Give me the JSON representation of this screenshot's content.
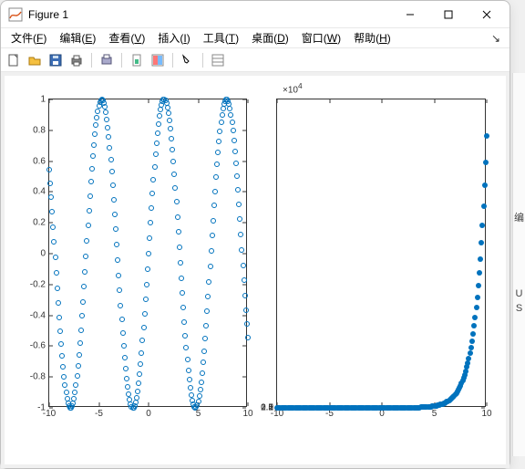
{
  "window": {
    "title": "Figure 1"
  },
  "menu": {
    "file": "文件(F)",
    "edit": "编辑(E)",
    "view": "查看(V)",
    "insert": "插入(I)",
    "tools": "工具(T)",
    "desktop": "桌面(D)",
    "window": "窗口(W)",
    "help": "帮助(H)"
  },
  "chart_data": [
    {
      "type": "scatter",
      "marker": "open-circle",
      "color": "#0072bd",
      "x_expr": "linspace(-10, 10, 201)",
      "y_expr": "sin(x)",
      "xlim": [
        -10,
        10
      ],
      "ylim": [
        -1,
        1
      ],
      "xticks": [
        -10,
        -5,
        0,
        5,
        10
      ],
      "yticks": [
        -1,
        -0.8,
        -0.6,
        -0.4,
        -0.2,
        0,
        0.2,
        0.4,
        0.6,
        0.8,
        1
      ]
    },
    {
      "type": "scatter",
      "marker": "filled-circle",
      "color": "#0072bd",
      "x_expr": "linspace(-10, 10, 201)",
      "y_expr": "exp(x)",
      "xlim": [
        -10,
        10
      ],
      "ylim": [
        0,
        25000
      ],
      "y_exponent_label": "×10^4",
      "xticks": [
        -10,
        -5,
        0,
        5,
        10
      ],
      "yticks": [
        0,
        0.5,
        1,
        1.5,
        2,
        2.5
      ]
    }
  ],
  "side": {
    "a": "编",
    "b": "U",
    "c": "S"
  }
}
